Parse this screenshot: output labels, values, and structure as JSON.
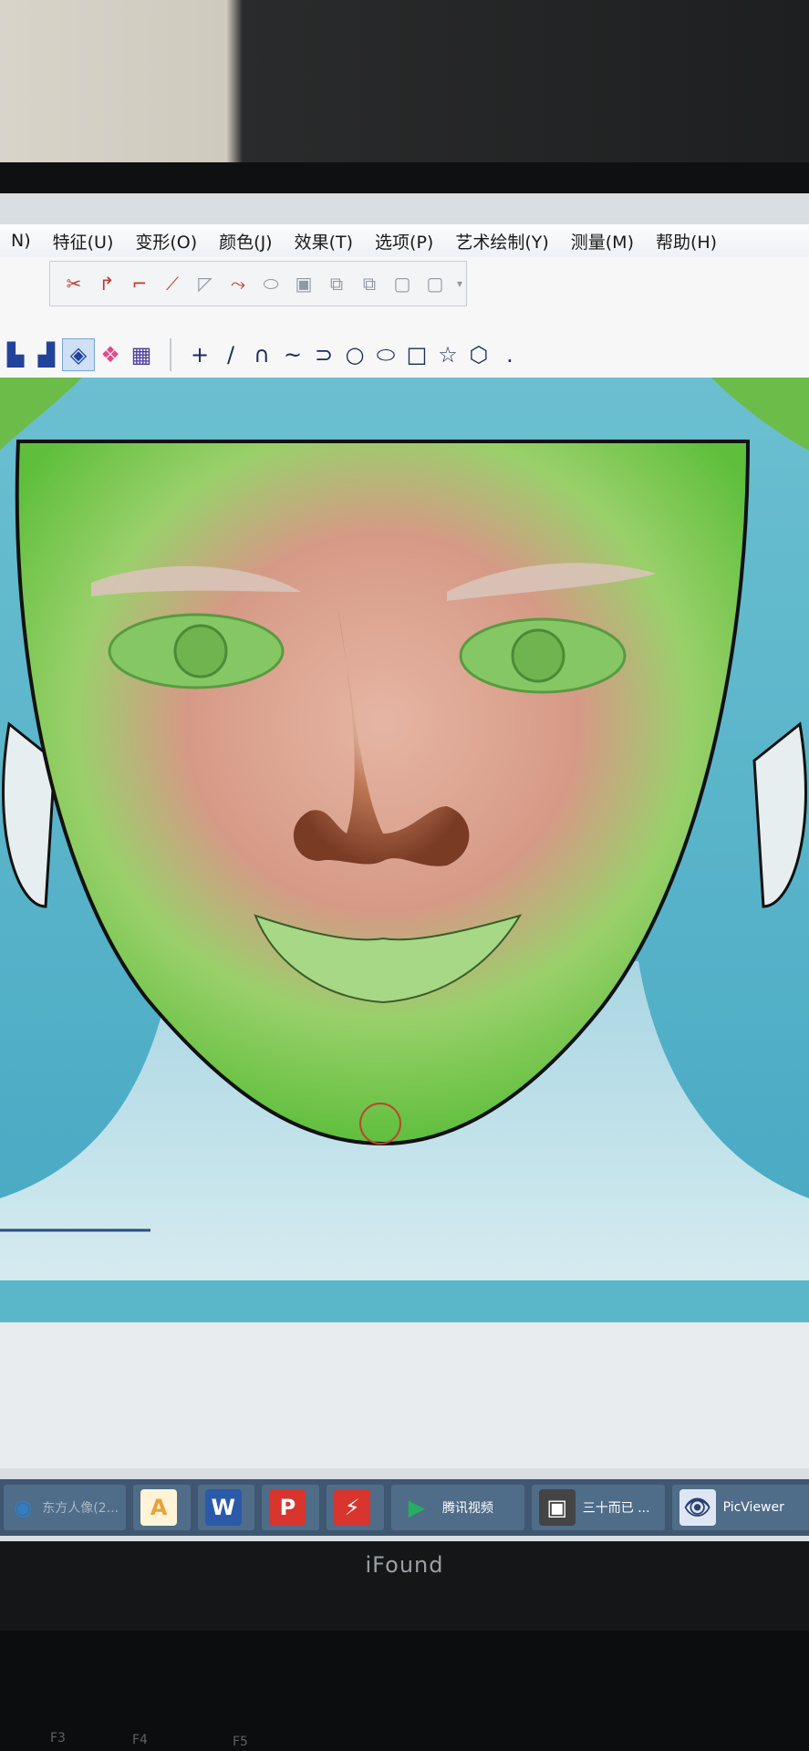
{
  "menu": {
    "items": [
      {
        "label": "N)"
      },
      {
        "label": "特征(U)"
      },
      {
        "label": "变形(O)"
      },
      {
        "label": "颜色(J)"
      },
      {
        "label": "效果(T)"
      },
      {
        "label": "选项(P)"
      },
      {
        "label": "艺术绘制(Y)"
      },
      {
        "label": "测量(M)"
      },
      {
        "label": "帮助(H)"
      }
    ]
  },
  "toolbar_top": {
    "icons": [
      "scissors-icon",
      "curve-arrow-icon",
      "fillet-icon",
      "chamfer-icon",
      "page-fold-icon",
      "blend-icon",
      "pill-icon",
      "square-icon",
      "copy-squares-icon",
      "stack-squares-icon",
      "grey-square-icon",
      "grey-square-icon-2",
      "dropdown-icon"
    ]
  },
  "toolbar_shapes": {
    "left_icons": [
      "bar-chart-icon",
      "chart-icon",
      "mesh-icon",
      "colors-icon",
      "grid-icon"
    ],
    "shapes": [
      "+",
      "/",
      "∩",
      "~",
      "⊃",
      "○",
      "⬭",
      "□",
      "☆",
      "⬡",
      "."
    ]
  },
  "taskbar": {
    "items": [
      {
        "label": "东方人像(2...",
        "icon_text": "◉",
        "icon_color": "#2d7fc9"
      },
      {
        "label": "",
        "icon_text": "A",
        "icon_color": "#e6a23c"
      },
      {
        "label": "",
        "icon_text": "W",
        "icon_color": "#2b5aa8"
      },
      {
        "label": "",
        "icon_text": "P",
        "icon_color": "#d8352f"
      },
      {
        "label": "",
        "icon_text": "⚡",
        "icon_color": "#d8352f"
      },
      {
        "label": "腾讯视频",
        "icon_text": "▶",
        "icon_color": "#27ae60"
      },
      {
        "label": "三十而已 ...",
        "icon_text": "▣",
        "icon_color": "#444"
      },
      {
        "label": "PicViewer",
        "icon_text": "👁",
        "icon_color": "#2b3f73"
      }
    ]
  },
  "monitor": {
    "brand": "iFound"
  },
  "keyboard": {
    "labels": [
      "F3",
      "F4",
      "F5"
    ]
  }
}
